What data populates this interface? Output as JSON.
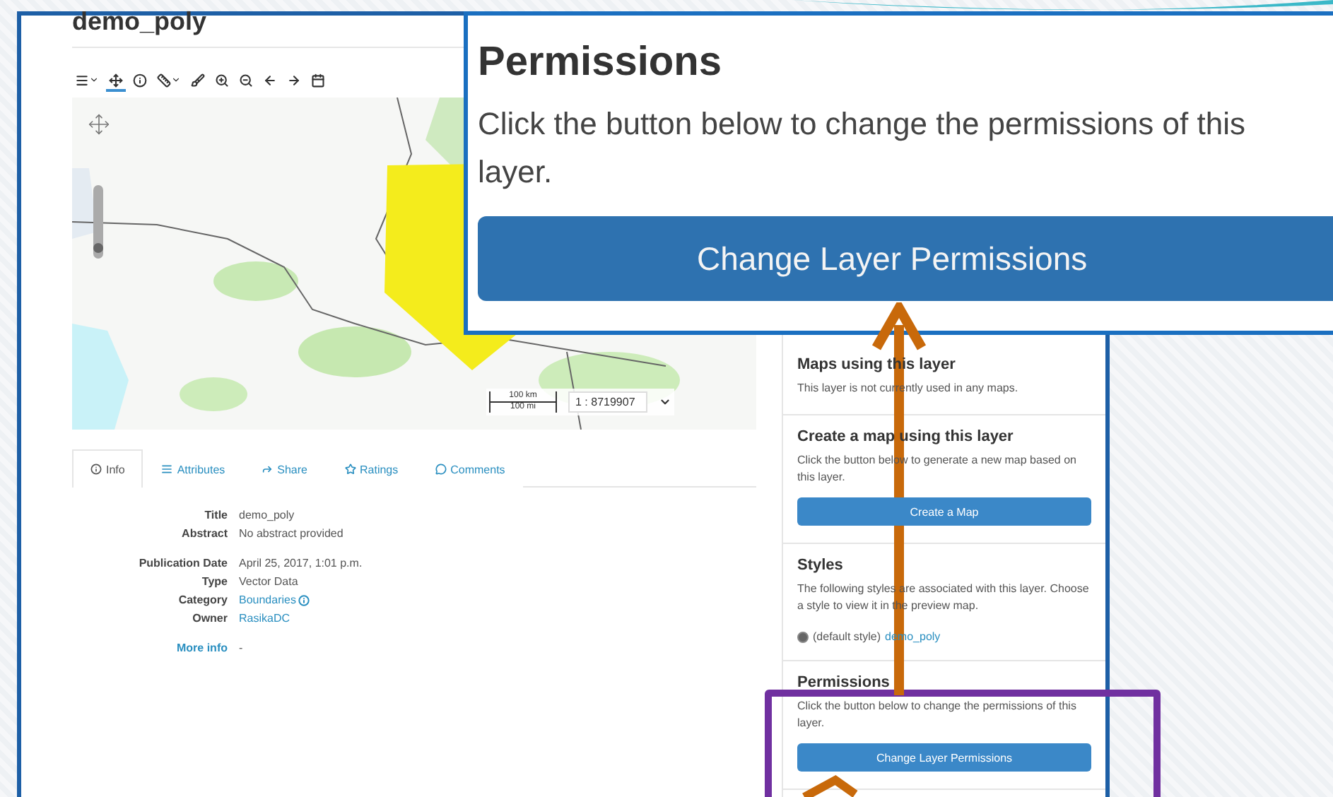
{
  "page": {
    "title": "demo_poly"
  },
  "map_tools": [
    {
      "kind": "menu",
      "selected": false
    },
    {
      "kind": "pan",
      "selected": true
    },
    {
      "kind": "info",
      "selected": false
    },
    {
      "kind": "measure",
      "selected": false
    },
    {
      "kind": "brush",
      "selected": false
    },
    {
      "kind": "zoom-in",
      "selected": false
    },
    {
      "kind": "zoom-out",
      "selected": false
    },
    {
      "kind": "back",
      "selected": false
    },
    {
      "kind": "forward",
      "selected": false
    },
    {
      "kind": "calendar",
      "selected": false
    }
  ],
  "map": {
    "zoom": {
      "level": 0.1
    },
    "scale_km": "100 km",
    "scale_mi": "100 mi",
    "scale_ratio": "1 : 8719907"
  },
  "tabs": [
    {
      "kind": "info",
      "label": "Info",
      "selected": true
    },
    {
      "kind": "attributes",
      "label": "Attributes",
      "selected": false
    },
    {
      "kind": "share",
      "label": "Share",
      "selected": false
    },
    {
      "kind": "ratings",
      "label": "Ratings",
      "selected": false
    },
    {
      "kind": "comments",
      "label": "Comments",
      "selected": false
    }
  ],
  "info": {
    "groups": [
      [
        {
          "label": "Title",
          "value": "demo_poly",
          "kind": "text"
        },
        {
          "label": "Abstract",
          "value": "No abstract provided",
          "kind": "text"
        }
      ],
      [
        {
          "label": "Publication Date",
          "value": "April 25, 2017, 1:01 p.m.",
          "kind": "text"
        },
        {
          "label": "Type",
          "value": "Vector Data",
          "kind": "text"
        },
        {
          "label": "Category",
          "value": "Boundaries",
          "kind": "link-info"
        },
        {
          "label": "Owner",
          "value": "RasikaDC",
          "kind": "link"
        }
      ]
    ],
    "more_info": {
      "label": "More info",
      "value": "-"
    }
  },
  "sidebar": {
    "cards": [
      {
        "title": "Maps using this layer",
        "text": "This layer is not currently used in any maps."
      },
      {
        "title": "Create a map using this layer",
        "text": "Click the button below to generate a new map based on this layer.",
        "button": "Create a Map"
      },
      {
        "title": "Styles",
        "text": "The following styles are associated with this layer. Choose a style to view it in the preview map.",
        "styles": [
          {
            "label": "(default style)",
            "link": "demo_poly",
            "selected": true
          }
        ]
      },
      {
        "title": "Permissions",
        "text": "Click the button below to change the permissions of this layer.",
        "button": "Change Layer Permissions"
      }
    ]
  },
  "callout": {
    "title": "Permissions",
    "text": "Click the button below to change the permissions of this layer.",
    "button": "Change Layer Permissions"
  }
}
